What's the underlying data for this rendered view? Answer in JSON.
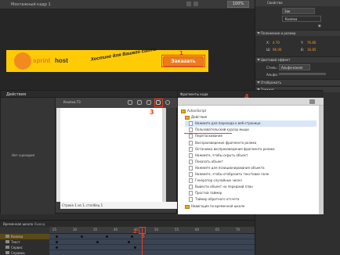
{
  "top": {
    "scene_name": "Монтажный кадр 1",
    "zoom": "100%"
  },
  "banner": {
    "logo_part1": "sprint",
    "logo_part2": "host",
    "slogan": "Хостинг для Вашего сайта",
    "button_label": "Заказать",
    "annotation": "1"
  },
  "props": {
    "tab_label": "Свойства",
    "field_top": "Зак",
    "button_instance": "Кнопка",
    "section_position": "Положение и размер",
    "x_label": "X:",
    "x_value": "4.70",
    "y_label": "Y:",
    "y_value": "76.80",
    "w_label": "Ш:",
    "w_value": "96.00",
    "h_label": "В:",
    "h_value": "16.85",
    "section_color": "Цветовой эффект",
    "style_label": "Стиль:",
    "style_value": "Альфа-канал",
    "alpha_label": "Альфа:",
    "section_display": "Отображать",
    "section_tracking": "Трекинг"
  },
  "actions": {
    "title": "Действия",
    "left_label": "Нет сценария",
    "tab_label": "Кнопка:73",
    "status": "Строка 1 из 1, столбец 1",
    "annotation": "3"
  },
  "snippets": {
    "title": "Фрагменты кода",
    "annotation": "4",
    "tree": [
      {
        "label": "ActionScript",
        "type": "folder",
        "level": 0
      },
      {
        "label": "Действия",
        "type": "folder",
        "level": 1
      },
      {
        "label": "Нажмите для перехода к веб-странице",
        "type": "file",
        "level": 2,
        "selected": true
      },
      {
        "label": "Пользовательский курсор мыши",
        "type": "file",
        "level": 2
      },
      {
        "label": "Перетаскивание",
        "type": "file",
        "level": 2
      },
      {
        "label": "Воспроизведение фрагмента ролика",
        "type": "file",
        "level": 2
      },
      {
        "label": "Остановка воспроизведения фрагмента ролика",
        "type": "file",
        "level": 2
      },
      {
        "label": "Нажмите, чтобы скрыть объект",
        "type": "file",
        "level": 2
      },
      {
        "label": "Показать объект",
        "type": "file",
        "level": 2
      },
      {
        "label": "Нажмите для позиционирования объекта",
        "type": "file",
        "level": 2
      },
      {
        "label": "Нажмите, чтобы отобразить текстовое поле",
        "type": "file",
        "level": 2
      },
      {
        "label": "Генератор случайных чисел",
        "type": "file",
        "level": 2
      },
      {
        "label": "Вывести объект на передний план",
        "type": "file",
        "level": 2
      },
      {
        "label": "Простой таймер",
        "type": "file",
        "level": 2
      },
      {
        "label": "Таймер обратного отсчета",
        "type": "file",
        "level": 2
      },
      {
        "label": "Навигация по временной шкале",
        "type": "folder",
        "level": 1
      }
    ]
  },
  "timeline": {
    "tab1": "Временная шкала",
    "tab2": "Вывод",
    "ruler": [
      "25",
      "30",
      "35",
      "40",
      "45",
      "50",
      "55",
      "60",
      "65",
      "70"
    ],
    "layers": [
      "Кнопка",
      "Текст",
      "Сервис",
      "Справка"
    ],
    "annotation_a": "2",
    "annotation_b": "5"
  }
}
